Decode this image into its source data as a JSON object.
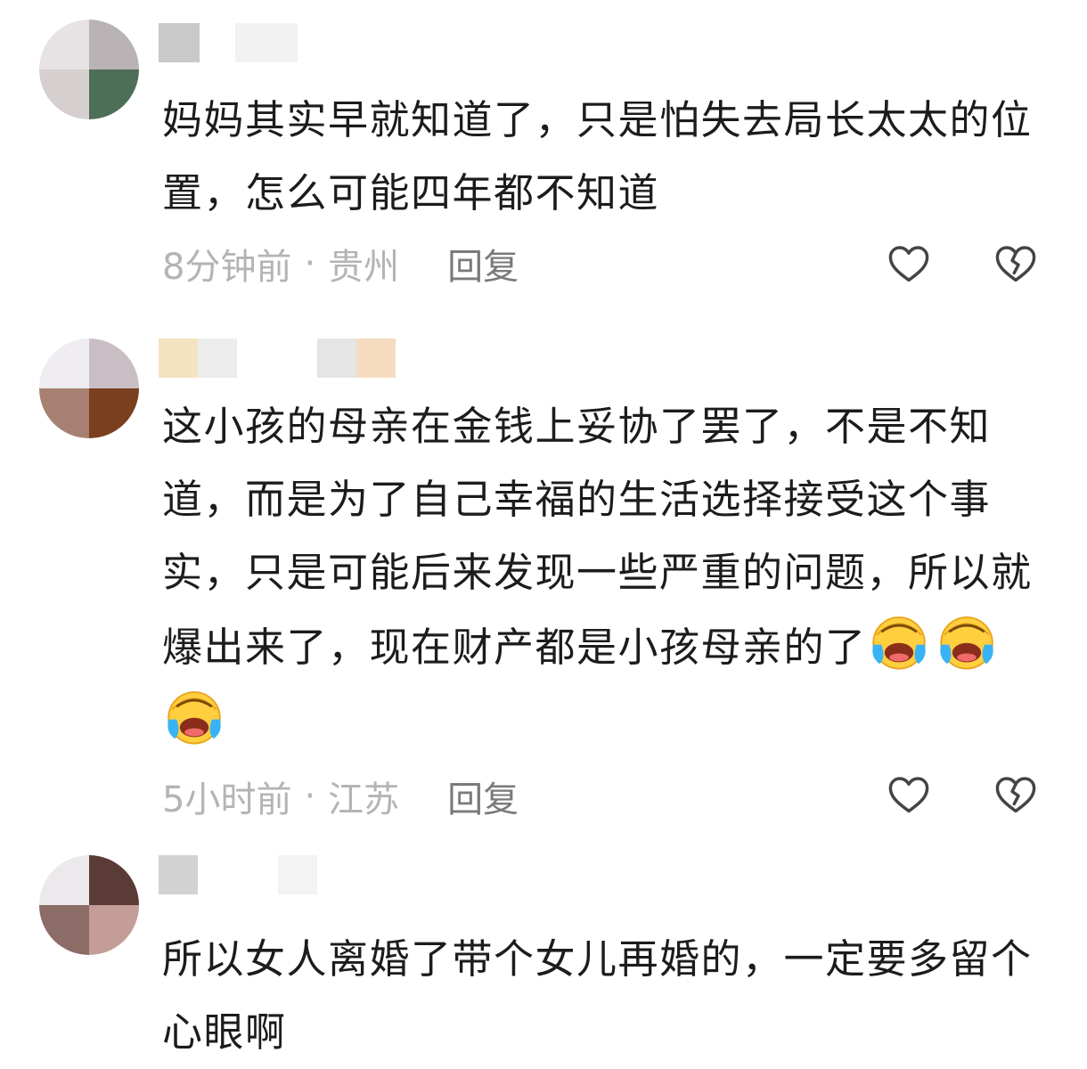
{
  "comments": [
    {
      "text": "妈妈其实早就知道了，只是怕失去局长太太的位置，怎么可能四年都不知道",
      "time": "8分钟前",
      "separator": "·",
      "location": "贵州",
      "reply_label": "回复",
      "like_icon": "heart-outline-icon",
      "dislike_icon": "broken-heart-icon"
    },
    {
      "text": "这小孩的母亲在金钱上妥协了罢了，不是不知道，而是为了自己幸福的生活选择接受这个事实，只是可能后来发现一些严重的问题，所以就爆出来了，现在财产都是小孩母亲的了",
      "emoji": "crying-laughing-emoji",
      "emoji_count": 3,
      "time": "5小时前",
      "separator": "·",
      "location": "江苏",
      "reply_label": "回复",
      "like_icon": "heart-outline-icon",
      "dislike_icon": "broken-heart-icon"
    },
    {
      "text": "所以女人离婚了带个女儿再婚的，一定要多留个心眼啊"
    }
  ],
  "colors": {
    "meta_text": "#b4b4b4",
    "reply_text": "#7a7a7a",
    "body_text": "#1c1c1c",
    "icon_stroke": "#444444"
  }
}
